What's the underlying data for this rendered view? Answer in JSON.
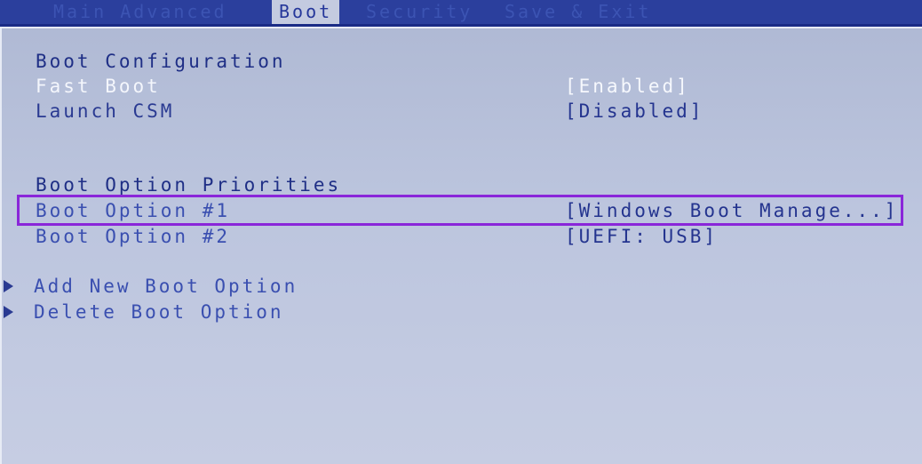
{
  "tabs": [
    {
      "label": "Main  Advanced"
    },
    {
      "label": "Boot"
    },
    {
      "label": "Security"
    },
    {
      "label": "Save & Exit"
    }
  ],
  "boot_configuration": {
    "heading": "Boot Configuration",
    "fast_boot": {
      "label": "Fast Boot",
      "value": "[Enabled]"
    },
    "launch_csm": {
      "label": "Launch CSM",
      "value": "[Disabled]"
    }
  },
  "boot_priorities": {
    "heading": "Boot Option Priorities",
    "options": [
      {
        "label": "Boot Option #1",
        "value": "[Windows Boot Manage...]"
      },
      {
        "label": "Boot Option #2",
        "value": "[UEFI:  USB]"
      }
    ]
  },
  "actions": [
    {
      "label": "Add New Boot Option"
    },
    {
      "label": "Delete Boot Option"
    }
  ],
  "colors": {
    "background": "#bcc5de",
    "tab_bar": "#2b3f9d",
    "text": "#2a3a92",
    "selected_text": "#f4f6fc",
    "highlight_outline": "#8a26d9"
  }
}
